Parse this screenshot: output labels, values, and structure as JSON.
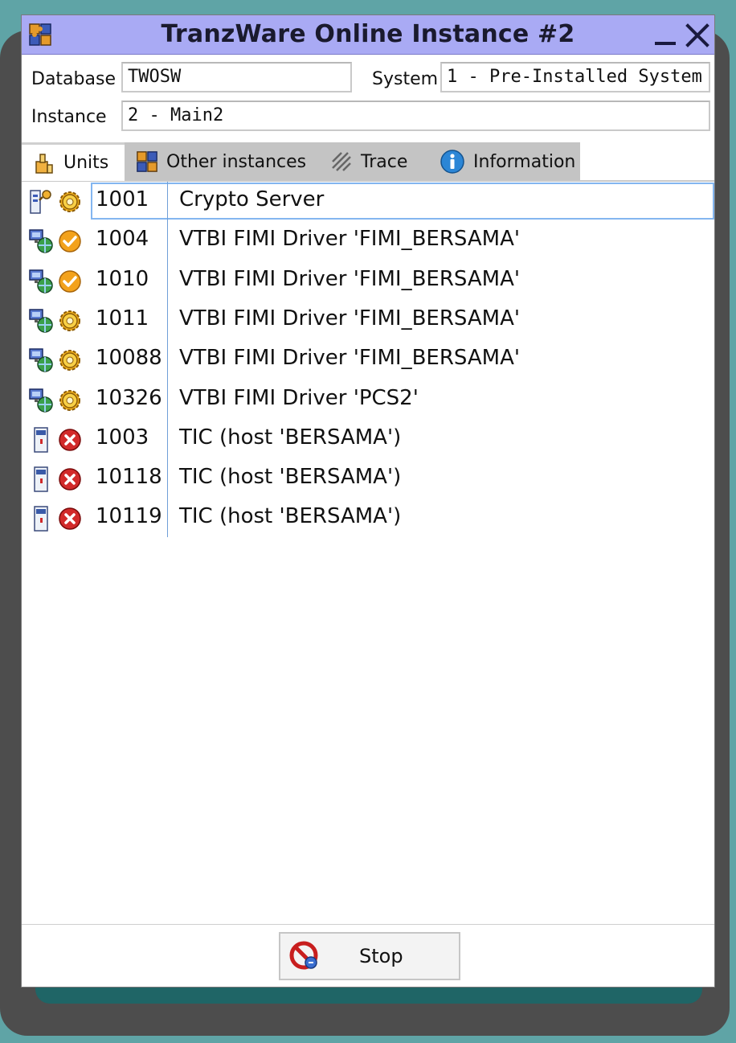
{
  "window": {
    "title": "TranzWare Online Instance #2",
    "app_icon": "puzzle-icon",
    "minimize_icon": "minimize-icon",
    "close_icon": "close-icon"
  },
  "form": {
    "database_label": "Database",
    "database_value": "TWOSW",
    "system_label": "System",
    "system_value": "1 - Pre-Installed System",
    "instance_label": "Instance",
    "instance_value": "2 - Main2"
  },
  "tabs": [
    {
      "label": "Units",
      "icon": "units-icon",
      "active": true
    },
    {
      "label": "Other instances",
      "icon": "puzzle-icon",
      "active": false
    },
    {
      "label": "Trace",
      "icon": "trace-icon",
      "active": false
    },
    {
      "label": "Information",
      "icon": "info-icon",
      "active": false
    }
  ],
  "units": [
    {
      "id": "1001",
      "name": "Crypto Server",
      "type_icon": "crypto-key-icon",
      "status_icon": "gear-status-icon",
      "selected": true
    },
    {
      "id": "1004",
      "name": "VTBI FIMI Driver 'FIMI_BERSAMA'",
      "type_icon": "network-driver-icon",
      "status_icon": "check-status-icon",
      "selected": false
    },
    {
      "id": "1010",
      "name": "VTBI FIMI Driver 'FIMI_BERSAMA'",
      "type_icon": "network-driver-icon",
      "status_icon": "check-status-icon",
      "selected": false
    },
    {
      "id": "1011",
      "name": "VTBI FIMI Driver 'FIMI_BERSAMA'",
      "type_icon": "network-driver-icon",
      "status_icon": "gear-status-icon",
      "selected": false
    },
    {
      "id": "10088",
      "name": "VTBI FIMI Driver 'FIMI_BERSAMA'",
      "type_icon": "network-driver-icon",
      "status_icon": "gear-status-icon",
      "selected": false
    },
    {
      "id": "10326",
      "name": "VTBI FIMI Driver 'PCS2'",
      "type_icon": "network-driver-icon",
      "status_icon": "gear-status-icon",
      "selected": false
    },
    {
      "id": "1003",
      "name": "TIC (host 'BERSAMA')",
      "type_icon": "terminal-icon",
      "status_icon": "error-status-icon",
      "selected": false
    },
    {
      "id": "10118",
      "name": "TIC (host 'BERSAMA')",
      "type_icon": "terminal-icon",
      "status_icon": "error-status-icon",
      "selected": false
    },
    {
      "id": "10119",
      "name": "TIC (host 'BERSAMA')",
      "type_icon": "terminal-icon",
      "status_icon": "error-status-icon",
      "selected": false
    }
  ],
  "footer": {
    "stop_label": "Stop",
    "stop_icon": "stop-icon"
  },
  "colors": {
    "titlebar": "#a9aaf4",
    "desktop": "#5fa4a6",
    "selection_border": "#84b6f0",
    "error_red": "#d22a2a",
    "status_orange": "#f3a21c"
  }
}
